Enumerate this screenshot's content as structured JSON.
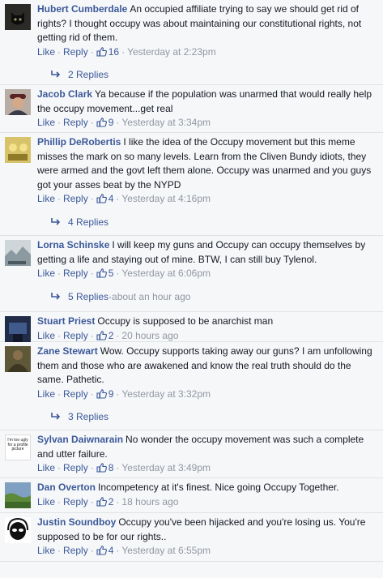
{
  "labels": {
    "like": "Like",
    "reply": "Reply",
    "sep": "·"
  },
  "colors": {
    "link": "#3b5998",
    "meta": "#9197a3",
    "background": "#f6f7f9"
  },
  "comments": [
    {
      "author": "Hubert Cumberdale",
      "text": "An occupied affiliate trying to say we should get rid of rights? I thought occupy was about maintaining our constitutional rights, not getting rid of them.",
      "likes": "16",
      "time": "Yesterday at 2:23pm",
      "replies": "2 Replies",
      "replies_time": "",
      "avatar": "dark-cat"
    },
    {
      "author": "Jacob Clark",
      "text": "Ya because if the population was unarmed that would really help the occupy movement...get real",
      "likes": "9",
      "time": "Yesterday at 3:34pm",
      "replies": "",
      "replies_time": "",
      "avatar": "man-cap"
    },
    {
      "author": "Phillip DeRobertis",
      "text": "I like the idea of the Occupy movement but this meme misses the mark on so many levels. Learn from the Cliven Bundy idiots, they were armed and the govt left them alone. Occupy was unarmed and you guys got your asses beat by the NYPD",
      "likes": "4",
      "time": "Yesterday at 4:16pm",
      "replies": "4 Replies",
      "replies_time": "",
      "avatar": "yellow-cartoon"
    },
    {
      "author": "Lorna Schinske",
      "text": "I will keep my guns and Occupy can occupy themselves by getting a life and staying out of mine. BTW, I can still buy Tylenol.",
      "likes": "5",
      "time": "Yesterday at 6:06pm",
      "replies": "5 Replies",
      "replies_time": "about an hour ago",
      "avatar": "snowy-scene"
    },
    {
      "author": "Stuart Priest",
      "text": "Occupy is supposed to be anarchist man",
      "likes": "2",
      "time": "20 hours ago",
      "replies": "",
      "replies_time": "",
      "avatar": "blue-night"
    },
    {
      "author": "Zane Stewart",
      "text": "Wow. Occupy supports taking away our guns? I am unfollowing them and those who are awakened and know the real truth should do the same. Pathetic.",
      "likes": "9",
      "time": "Yesterday at 3:32pm",
      "replies": "3 Replies",
      "replies_time": "",
      "avatar": "soldier"
    },
    {
      "author": "Sylvan Daiwnarain",
      "text": "No wonder the occupy movement was such a complete and utter failure.",
      "likes": "8",
      "time": "Yesterday at 3:49pm",
      "replies": "",
      "replies_time": "",
      "avatar": "text-picture",
      "avatar_text": "I'm too ugly for a profile picture"
    },
    {
      "author": "Dan Overton",
      "text": "Incompetency at it's finest. Nice going Occupy Together.",
      "likes": "2",
      "time": "18 hours ago",
      "replies": "",
      "replies_time": "",
      "avatar": "green-landscape"
    },
    {
      "author": "Justin Soundboy",
      "text": "Occupy you've been hijacked and you're losing us. You're supposed to be for our rights..",
      "likes": "4",
      "time": "Yesterday at 6:55pm",
      "replies": "",
      "replies_time": "",
      "avatar": "alien-headphones"
    }
  ]
}
